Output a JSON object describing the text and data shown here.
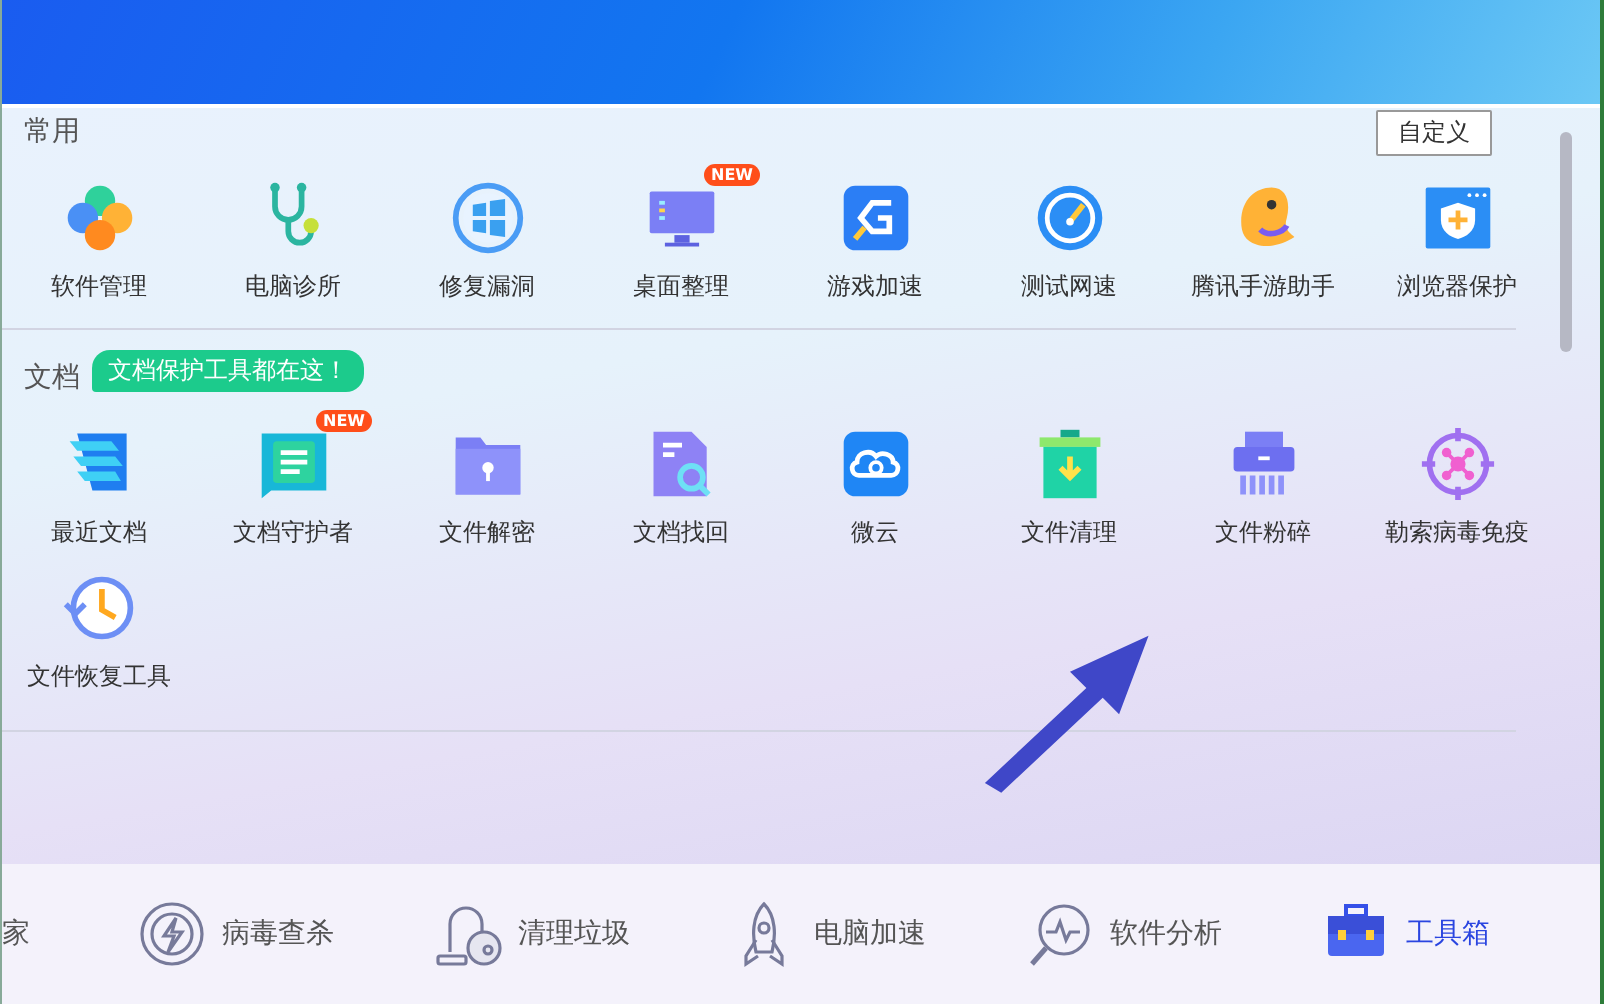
{
  "sections": [
    {
      "title": "常用",
      "action": "自定义",
      "items": [
        {
          "label": "软件管理"
        },
        {
          "label": "电脑诊所"
        },
        {
          "label": "修复漏洞"
        },
        {
          "label": "桌面整理",
          "badge": "NEW"
        },
        {
          "label": "游戏加速"
        },
        {
          "label": "测试网速"
        },
        {
          "label": "腾讯手游助手"
        },
        {
          "label": "浏览器保护"
        }
      ]
    },
    {
      "title": "文档",
      "tag": "文档保护工具都在这！",
      "items": [
        {
          "label": "最近文档"
        },
        {
          "label": "文档守护者",
          "badge": "NEW"
        },
        {
          "label": "文件解密"
        },
        {
          "label": "文档找回"
        },
        {
          "label": "微云"
        },
        {
          "label": "文件清理"
        },
        {
          "label": "文件粉碎"
        },
        {
          "label": "勒索病毒免疫"
        },
        {
          "label": "文件恢复工具"
        }
      ]
    }
  ],
  "bottom_nav": [
    {
      "label": "家",
      "selected": false
    },
    {
      "label": "病毒查杀",
      "selected": false
    },
    {
      "label": "清理垃圾",
      "selected": false
    },
    {
      "label": "电脑加速",
      "selected": false
    },
    {
      "label": "软件分析",
      "selected": false
    },
    {
      "label": "工具箱",
      "selected": true
    }
  ]
}
